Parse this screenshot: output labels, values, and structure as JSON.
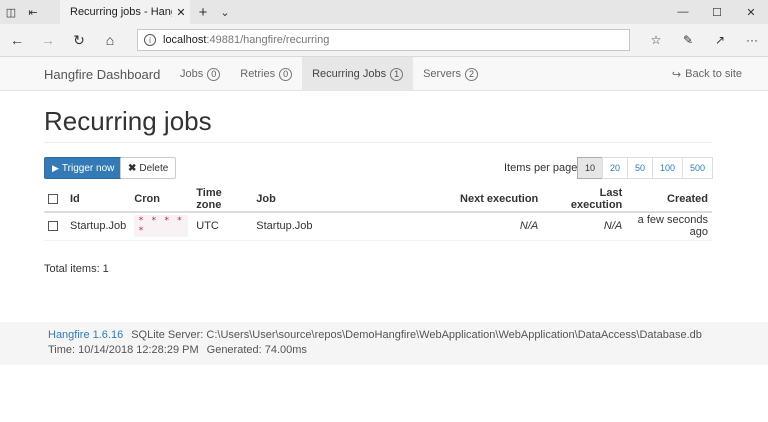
{
  "browser": {
    "tab_title": "Recurring jobs - Hangfire",
    "url_host": "localhost",
    "url_path": ":49881/hangfire/recurring",
    "icons": [
      "tab-manage-icon",
      "set-aside-icon",
      "close-icon",
      "plus-icon",
      "chevron-down-icon",
      "minimize-icon",
      "maximize-icon",
      "back-arrow-icon",
      "forward-arrow-icon",
      "refresh-icon",
      "home-icon",
      "info-icon",
      "favorites-icon",
      "pen-icon",
      "share-icon",
      "more-icon"
    ]
  },
  "nav": {
    "brand": "Hangfire Dashboard",
    "items": [
      {
        "label": "Jobs",
        "count": "0"
      },
      {
        "label": "Retries",
        "count": "0"
      },
      {
        "label": "Recurring Jobs",
        "count": "1"
      },
      {
        "label": "Servers",
        "count": "2"
      }
    ],
    "back_to_site": "Back to site"
  },
  "page": {
    "title": "Recurring jobs",
    "trigger_now": "Trigger now",
    "delete": "Delete",
    "items_per_page_label": "Items per page:",
    "page_sizes": [
      "10",
      "20",
      "50",
      "100",
      "500"
    ],
    "selected_page_size": "10",
    "total_items": "Total items: 1"
  },
  "table": {
    "headers": [
      "Id",
      "Cron",
      "Time zone",
      "Job",
      "Next execution",
      "Last execution",
      "Created"
    ],
    "rows": [
      {
        "id": "Startup.Job",
        "cron": "* * * * *",
        "timezone": "UTC",
        "job": "Startup.Job",
        "next": "N/A",
        "last": "N/A",
        "created": "a few seconds ago"
      }
    ]
  },
  "footer": {
    "version": "Hangfire 1.6.16",
    "storage": "SQLite Server: C:\\Users\\User\\source\\repos\\DemoHangfire\\WebApplication\\WebApplication\\DataAccess\\Database.db",
    "time": "Time: 10/14/2018 12:28:29 PM",
    "generated": "Generated: 74.00ms"
  },
  "colors": {
    "primary": "#337ab7",
    "cron_text": "#c7254e",
    "cron_bg": "#f9f2f4",
    "nav_bg": "#f8f8f8",
    "footer_bg": "#f5f5f5"
  }
}
